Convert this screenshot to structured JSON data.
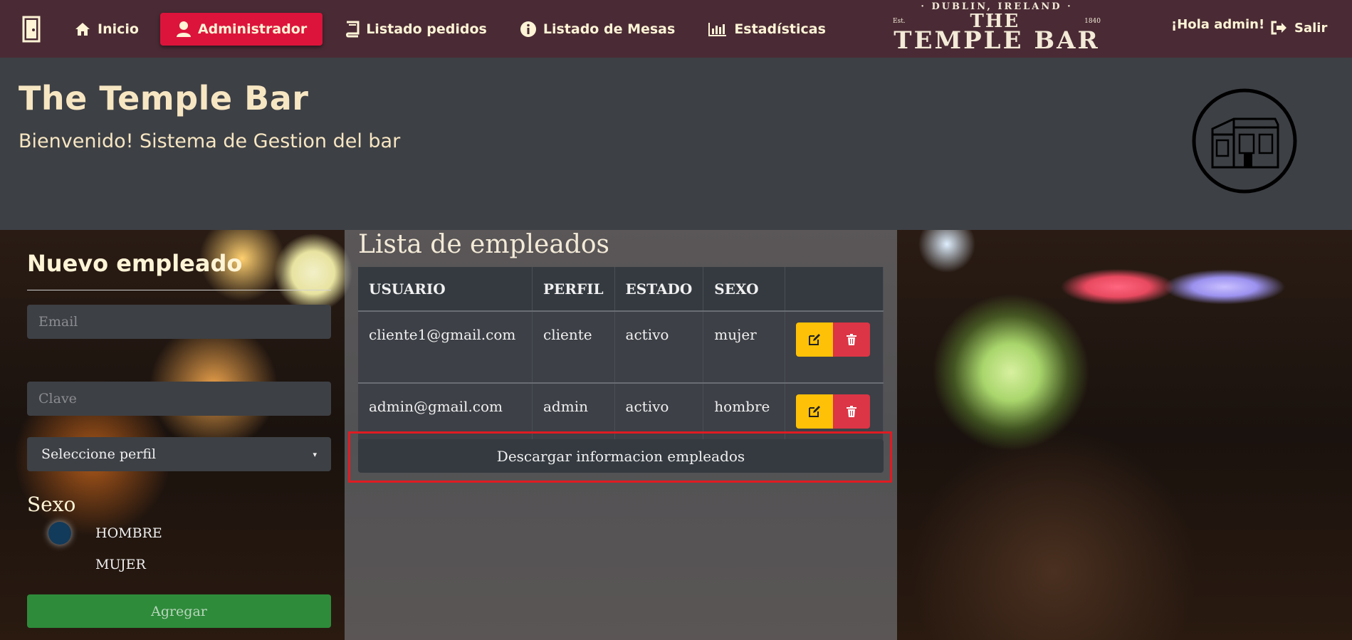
{
  "nav": {
    "items": [
      {
        "label": "Inicio",
        "icon": "home-icon"
      },
      {
        "label": "Administrador",
        "icon": "user-icon",
        "active": true
      },
      {
        "label": "Listado pedidos",
        "icon": "book-icon"
      },
      {
        "label": "Listado de Mesas",
        "icon": "info-icon"
      },
      {
        "label": "Estadísticas",
        "icon": "bar-chart-icon"
      }
    ],
    "logo": {
      "top": "· DUBLIN, IRELAND ·",
      "est": "Est.",
      "the": "THE",
      "year": "1840",
      "main": "TEMPLE BAR"
    },
    "greeting": "¡Hola admin!",
    "logout": "Salir"
  },
  "jumbo": {
    "title": "The Temple Bar",
    "subtitle": "Bienvenido! Sistema de Gestion del bar"
  },
  "form": {
    "title": "Nuevo empleado",
    "email_placeholder": "Email",
    "password_placeholder": "Clave",
    "profile_select": "Seleccione perfil",
    "sex_label": "Sexo",
    "options": [
      "HOMBRE",
      "MUJER"
    ],
    "submit": "Agregar"
  },
  "list": {
    "title": "Lista de empleados",
    "headers": [
      "USUARIO",
      "PERFIL",
      "ESTADO",
      "SEXO"
    ],
    "rows": [
      [
        "cliente1@gmail.com",
        "cliente",
        "activo",
        "mujer"
      ],
      [
        "admin@gmail.com",
        "admin",
        "activo",
        "hombre"
      ]
    ],
    "download": "Descargar informacion empleados"
  },
  "colors": {
    "navbar": "#4a2b35",
    "active": "#dc143c",
    "edit": "#ffc107",
    "delete": "#dc3545",
    "agregar": "#2e8b3a",
    "highlight": "#e01b22"
  }
}
